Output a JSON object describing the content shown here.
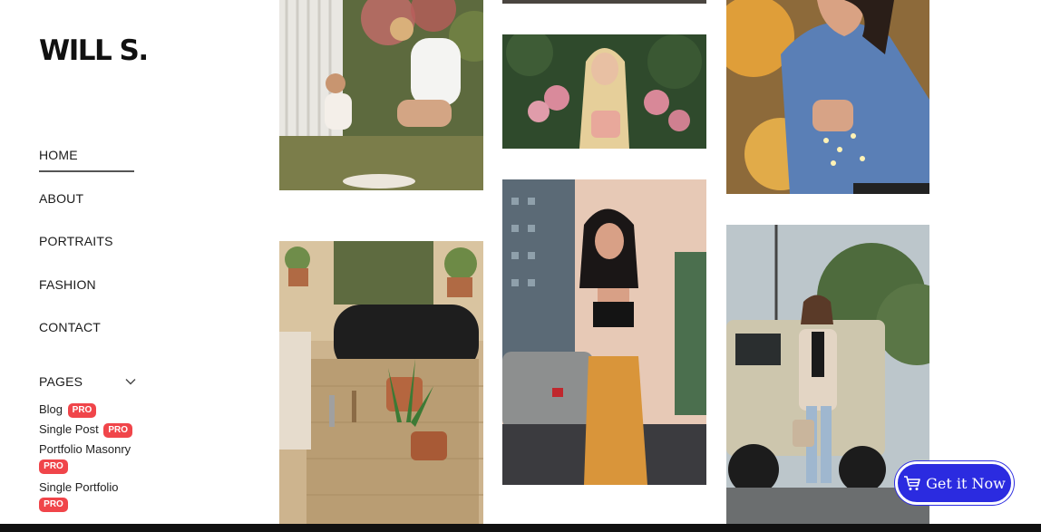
{
  "brand": {
    "logo": "WILL S."
  },
  "nav": {
    "items": [
      {
        "label": "HOME",
        "active": true
      },
      {
        "label": "ABOUT"
      },
      {
        "label": "PORTRAITS"
      },
      {
        "label": "FASHION"
      },
      {
        "label": "CONTACT"
      },
      {
        "label": "PAGES",
        "icon": "chevron-down-icon"
      }
    ]
  },
  "submenu": {
    "items": [
      {
        "label": "Blog",
        "badge": "PRO"
      },
      {
        "label": "Single Post",
        "badge": "PRO"
      },
      {
        "label": "Portfolio Masonry",
        "badge": "PRO"
      },
      {
        "label": "Single Portfolio",
        "badge": "PRO"
      }
    ]
  },
  "gallery": {
    "photos": [
      {
        "subject": "mother and child in garden"
      },
      {
        "subject": "woman with flowers"
      },
      {
        "subject": "woman in denim jacket with lights"
      },
      {
        "subject": "hands potting plants"
      },
      {
        "subject": "woman on city street"
      },
      {
        "subject": "woman beside jeep"
      }
    ]
  },
  "cta": {
    "label": "Get it Now",
    "icon": "cart-icon",
    "color": "#2b2be0"
  },
  "colors": {
    "accent": "#2b2be0",
    "badge": "#f0454a"
  }
}
